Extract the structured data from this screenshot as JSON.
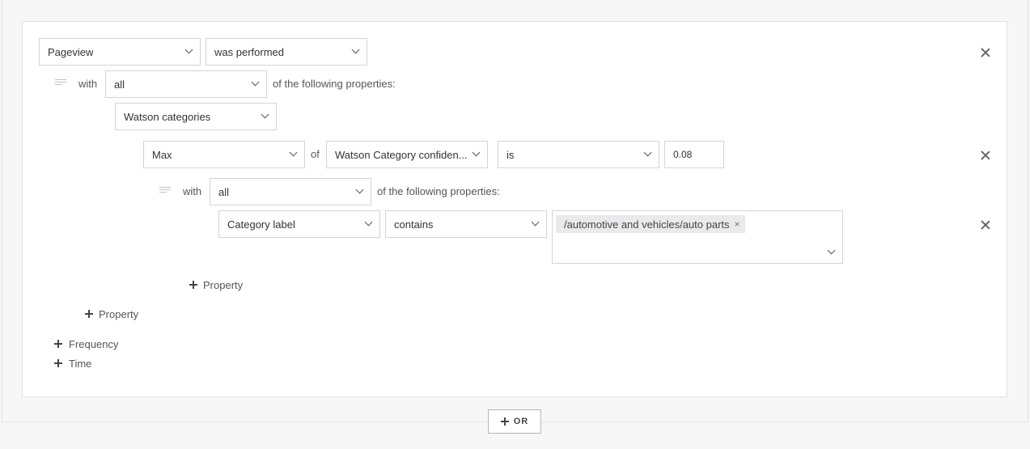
{
  "rule": {
    "event_select": "Pageview",
    "performed_select": "was performed",
    "with_label": "with",
    "match_select": "all",
    "following_text": "of the following properties:"
  },
  "property_group": {
    "property_select": "Watson categories",
    "aggregate_select": "Max",
    "of_label": "of",
    "field_select": "Watson Category confiden...",
    "operator_select": "is",
    "value_input": "0.08",
    "nested": {
      "with_label": "with",
      "match_select": "all",
      "following_text": "of the following properties:",
      "property_select": "Category label",
      "operator_select": "contains",
      "tags": [
        "/automotive and vehicles/auto parts"
      ],
      "tag_remove": "×"
    },
    "add_nested_property": "Property"
  },
  "add_property": "Property",
  "add_frequency": "Frequency",
  "add_time": "Time",
  "or_button": "OR"
}
